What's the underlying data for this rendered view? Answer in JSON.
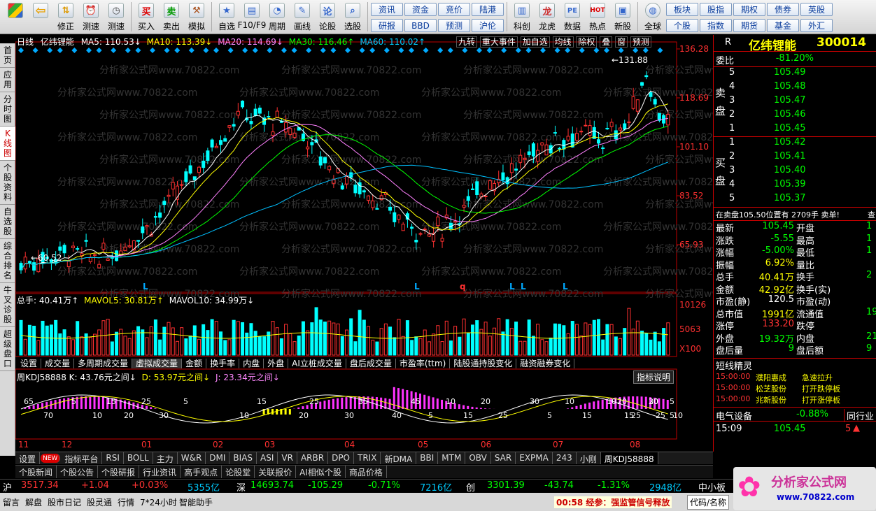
{
  "toolbar": {
    "buttons": [
      {
        "icon": "grid-icon",
        "label": ""
      },
      {
        "icon": "back-arrow-icon",
        "label": ""
      },
      {
        "icon": "update-arrows-icon",
        "label": "修正"
      },
      {
        "icon": "alarm-clock-icon",
        "label": "测速"
      },
      {
        "icon": "stopwatch-icon",
        "label": "测速"
      },
      {
        "icon": "buy-icon",
        "glyph": "买",
        "label": "买入"
      },
      {
        "icon": "sell-icon",
        "glyph": "卖",
        "label": "卖出"
      },
      {
        "icon": "hammer-icon",
        "label": "模拟"
      },
      {
        "icon": "star-icon",
        "label": "自选"
      },
      {
        "icon": "f10-icon",
        "label": "F10/F9"
      },
      {
        "icon": "cycle-icon",
        "label": "周期"
      },
      {
        "icon": "pen-icon",
        "label": "画线"
      },
      {
        "icon": "lun-icon",
        "glyph": "论",
        "label": "论股"
      },
      {
        "icon": "magnify-icon",
        "label": "选股"
      },
      {
        "icon": "chart-icon",
        "label": "科创"
      },
      {
        "icon": "dragon-icon",
        "label": "龙虎"
      },
      {
        "icon": "pe-icon",
        "label": "数据"
      },
      {
        "icon": "hot-icon",
        "label": "热点"
      },
      {
        "icon": "new-stock-icon",
        "label": "新股"
      },
      {
        "icon": "globe-icon",
        "label": "全球"
      }
    ],
    "mid_buttons": [
      [
        "资讯",
        "研报"
      ],
      [
        "资金",
        "BBD"
      ],
      [
        "竞价",
        "预测"
      ],
      [
        "陆港",
        "沪伦"
      ]
    ],
    "right_buttons": [
      [
        "板块",
        "个股"
      ],
      [
        "股指",
        "指数"
      ],
      [
        "期权",
        "期货"
      ],
      [
        "债券",
        "基金"
      ],
      [
        "英股",
        "外汇"
      ]
    ]
  },
  "left_tabs": [
    "首页",
    "应用",
    "分时图",
    "K线图",
    "个股资料",
    "自选股",
    "综合排名",
    "牛叉诊股",
    "超级盘口"
  ],
  "chart": {
    "period_label": "日线",
    "stock_name": "亿纬锂能",
    "ma": [
      {
        "label": "MA5: 110.53↓",
        "color": "#ffffff"
      },
      {
        "label": "MA10: 113.39↓",
        "color": "#ffff00"
      },
      {
        "label": "MA20: 114.69↓",
        "color": "#ff80ff"
      },
      {
        "label": "MA30: 116.46↑",
        "color": "#00ff00"
      },
      {
        "label": "MA60: 110.02↑",
        "color": "#00c0ff"
      }
    ],
    "tools": [
      "九转",
      "重大事件",
      "加自选",
      "均线",
      "除权",
      "叠",
      "窗",
      "预测"
    ],
    "price_axis": [
      "136.28",
      "118.69",
      "101.10",
      "83.52",
      "65.93"
    ],
    "high_label": "131.88",
    "low_label": "60.52",
    "watermark": "分析家公式网www.70822.com",
    "volume_info": [
      {
        "label": "总手: 40.41万↑",
        "color": "#ffffff"
      },
      {
        "label": "MAVOL5: 30.81万↑",
        "color": "#ffff00"
      },
      {
        "label": "MAVOL10: 34.99万↓",
        "color": "#ffffff"
      }
    ],
    "volume_axis": [
      "10126",
      "5063",
      "X100"
    ],
    "indicator_tabs": [
      "设置",
      "成交量",
      "多周期成交量",
      "虚拟成交量",
      "金额",
      "换手率",
      "内盘",
      "外盘",
      "AI立桩成交量",
      "盘后成交量",
      "市盈率(ttm)",
      "陆股通持股变化",
      "融资融券变化"
    ],
    "kdj_info": [
      {
        "label": "周KDJ58888 K: 43.76元之间↓",
        "color": "#ffffff"
      },
      {
        "label": "D: 53.97元之间↓",
        "color": "#ffff00"
      },
      {
        "label": "J: 23.34元之间↓",
        "color": "#ff80ff"
      }
    ],
    "kdj_button": "指标说明",
    "kdj_labels": [
      "65",
      "70",
      "5",
      "10",
      "15",
      "20",
      "25",
      "30",
      "5",
      "10",
      "15",
      "20",
      "25",
      "30",
      "35",
      "40",
      "45",
      "5",
      "10",
      "15",
      "20",
      "25",
      "30",
      "5",
      "10",
      "15",
      "20",
      "25",
      "30",
      "5",
      "10",
      "15",
      "20",
      "25",
      "5",
      "10"
    ],
    "months": [
      "11",
      "12",
      "01",
      "02",
      "03",
      "04",
      "05",
      "06",
      "07",
      "08"
    ]
  },
  "bottom_tabs": [
    "设置",
    "NEW",
    "指标平台",
    "RSI",
    "BOLL",
    "主力",
    "W&R",
    "DMI",
    "BIAS",
    "ASI",
    "VR",
    "ARBR",
    "DPO",
    "TRIX",
    "新DMA",
    "BBI",
    "MTM",
    "OBV",
    "SAR",
    "EXPMA",
    "243",
    "小刚",
    "周KDJ58888"
  ],
  "news_tabs": [
    "个股新闻",
    "个股公告",
    "个股研报",
    "行业资讯",
    "高手观点",
    "论股堂",
    "关联报价",
    "AI相似个股",
    "商品价格"
  ],
  "quote": {
    "code_prefix": "R",
    "name": "亿纬锂能",
    "code": "300014",
    "weibi_label": "委比",
    "weibi": "-81.20%",
    "sell_label": "卖盘",
    "buy_label": "买盘",
    "sell": [
      {
        "n": "5",
        "p": "105.49"
      },
      {
        "n": "4",
        "p": "105.48"
      },
      {
        "n": "3",
        "p": "105.47"
      },
      {
        "n": "2",
        "p": "105.46"
      },
      {
        "n": "1",
        "p": "105.45"
      }
    ],
    "buy": [
      {
        "n": "1",
        "p": "105.42"
      },
      {
        "n": "2",
        "p": "105.41"
      },
      {
        "n": "3",
        "p": "105.40"
      },
      {
        "n": "4",
        "p": "105.39"
      },
      {
        "n": "5",
        "p": "105.37"
      }
    ],
    "notice": "在卖盘105.50位置有 2709手 卖单!",
    "notice_btn": "查",
    "stats": [
      [
        "最新",
        "105.45",
        "开盘",
        "1"
      ],
      [
        "涨跌",
        "-5.55",
        "最高",
        "1"
      ],
      [
        "涨幅",
        "-5.00%",
        "最低",
        "1"
      ],
      [
        "振幅",
        "6.92%",
        "量比",
        ""
      ],
      [
        "总手",
        "40.41万",
        "换手",
        "2"
      ],
      [
        "金额",
        "42.92亿",
        "换手(实)",
        ""
      ],
      [
        "市盈(静)",
        "120.5",
        "市盈(动)",
        ""
      ],
      [
        "总市值",
        "1991亿",
        "流通值",
        "19"
      ],
      [
        "涨停",
        "133.20",
        "跌停",
        ""
      ],
      [
        "外盘",
        "19.32万",
        "内盘",
        "21"
      ],
      [
        "盘后量",
        "9",
        "盘后额",
        "9"
      ]
    ],
    "short_title": "短线精灵",
    "short_items": [
      [
        "15:00:00",
        "濮阳惠成",
        "急速拉升"
      ],
      [
        "15:00:00",
        "松芝股份",
        "打开跌停板"
      ],
      [
        "15:00:00",
        "兆新股份",
        "打开涨停板"
      ]
    ],
    "sector": "电气设备",
    "sector_pct": "-0.88%",
    "sector_btn": "同行业",
    "last_time": "15:09",
    "last_price": "105.45",
    "last_vol": "5"
  },
  "status": {
    "sh_label": "沪",
    "sh_val": "3517.34",
    "sh_chg": "+1.04",
    "sh_pct": "+0.03%",
    "sh_amt": "5355亿",
    "sz_label": "深",
    "sz_val": "14693.74",
    "sz_chg": "-105.29",
    "sz_pct": "-0.71%",
    "sz_amt": "7216亿",
    "cy_label": "创",
    "cy_val": "3301.39",
    "cy_chg": "-43.74",
    "cy_pct": "-1.31%",
    "cy_amt": "2948亿",
    "zx_label": "中小板"
  },
  "footer": {
    "items": [
      "留言",
      "解盘",
      "股市日记",
      "股灵通",
      "行情",
      "7*24小时",
      "智能助手"
    ],
    "news": "00:58 经参：强监管信号释放",
    "code_input": "代码/名称",
    "brand": "分析家公式网",
    "brand_url": "www.70822.com"
  },
  "colors": {
    "up": "#ff3030",
    "down": "#00ffff",
    "panel_border": "#c00000",
    "yellow": "#ffff00",
    "bg": "#000000"
  }
}
